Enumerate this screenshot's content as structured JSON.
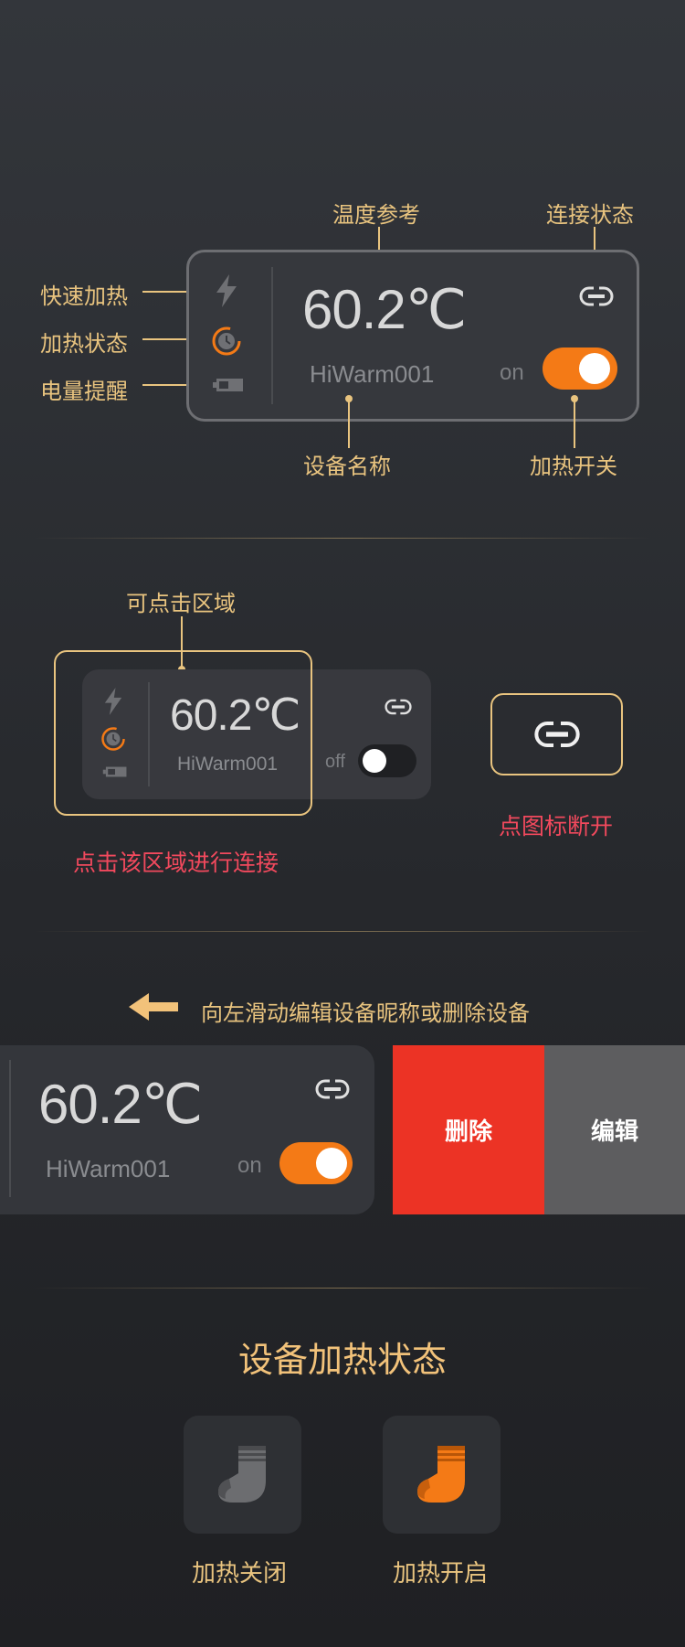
{
  "section1": {
    "labels": {
      "temp_ref": "温度参考",
      "conn_status": "连接状态",
      "fast_heat": "快速加热",
      "heat_status": "加热状态",
      "battery": "电量提醒",
      "device_name": "设备名称",
      "heat_switch": "加热开关"
    },
    "card": {
      "temperature": "60.2℃",
      "device": "HiWarm001",
      "toggle_label": "on",
      "toggle_state": true
    }
  },
  "section2": {
    "clickable_label": "可点击区域",
    "card": {
      "temperature": "60.2℃",
      "device": "HiWarm001",
      "toggle_label": "off",
      "toggle_state": false
    },
    "hint_connect": "点击该区域进行连接",
    "hint_disconnect": "点图标断开"
  },
  "section3": {
    "swipe_hint": "向左滑动编辑设备昵称或删除设备",
    "card": {
      "temperature": "60.2℃",
      "device": "HiWarm001",
      "toggle_label": "on",
      "toggle_state": true
    },
    "delete_label": "删除",
    "edit_label": "编辑"
  },
  "section4": {
    "title": "设备加热状态",
    "off_label": "加热关闭",
    "on_label": "加热开启"
  },
  "colors": {
    "accent": "#e9c47f",
    "orange": "#f47a16",
    "danger": "#ec3325",
    "pink": "#f2495d"
  },
  "icons": [
    "lightning-icon",
    "clock-icon",
    "battery-icon",
    "link-icon",
    "arrow-left-icon",
    "sock-icon"
  ]
}
